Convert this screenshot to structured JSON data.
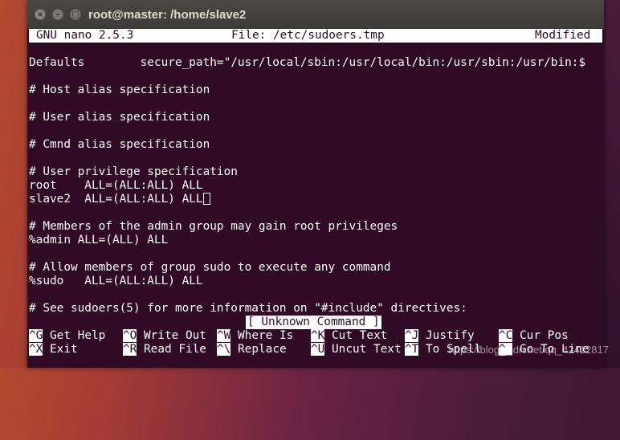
{
  "window": {
    "title": "root@master: /home/slave2",
    "buttons": {
      "close": "×",
      "minimize": "–",
      "maximize": "□"
    }
  },
  "nano": {
    "header": {
      "version": "GNU nano 2.5.3",
      "file": "File: /etc/sudoers.tmp",
      "state": "Modified"
    },
    "lines": [
      "Defaults        secure_path=\"/usr/local/sbin:/usr/local/bin:/usr/sbin:/usr/bin:$",
      "# Host alias specification",
      "# User alias specification",
      "# Cmnd alias specification",
      "# User privilege specification",
      "root    ALL=(ALL:ALL) ALL",
      "slave2  ALL=(ALL:ALL) ALL",
      "# Members of the admin group may gain root privileges",
      "%admin ALL=(ALL) ALL",
      "# Allow members of group sudo to execute any command",
      "%sudo   ALL=(ALL:ALL) ALL",
      "# See sudoers(5) for more information on \"#include\" directives:"
    ],
    "status": "[ Unknown Command ]",
    "shortcuts_row1": [
      {
        "key": "^G",
        "label": "Get Help"
      },
      {
        "key": "^O",
        "label": "Write Out"
      },
      {
        "key": "^W",
        "label": "Where Is"
      },
      {
        "key": "^K",
        "label": "Cut Text"
      },
      {
        "key": "^J",
        "label": "Justify"
      },
      {
        "key": "^C",
        "label": "Cur Pos"
      }
    ],
    "shortcuts_row2": [
      {
        "key": "^X",
        "label": "Exit"
      },
      {
        "key": "^R",
        "label": "Read File"
      },
      {
        "key": "^\\",
        "label": "Replace"
      },
      {
        "key": "^U",
        "label": "Uncut Text"
      },
      {
        "key": "^T",
        "label": "To Spell"
      },
      {
        "key": "^_",
        "label": "Go To Line"
      }
    ]
  },
  "watermark": "https://blog.csdn.net/qq_42412817"
}
